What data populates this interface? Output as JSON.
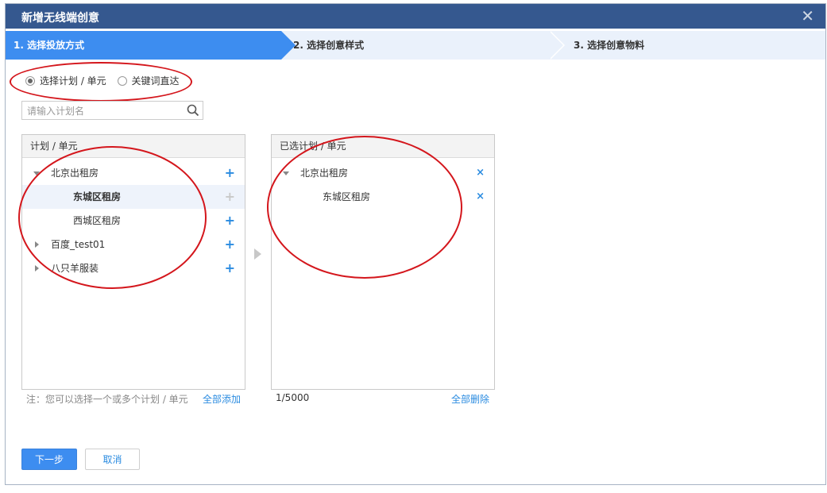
{
  "dialog": {
    "title": "新增无线端创意",
    "close_icon": "close-icon"
  },
  "steps": [
    {
      "label": "1. 选择投放方式",
      "active": true
    },
    {
      "label": "2. 选择创意样式",
      "active": false
    },
    {
      "label": "3. 选择创意物料",
      "active": false
    }
  ],
  "mode": {
    "options": [
      {
        "label": "选择计划 / 单元",
        "checked": true
      },
      {
        "label": "关键词直达",
        "checked": false
      }
    ]
  },
  "search": {
    "placeholder": "请输入计划名",
    "value": "",
    "icon": "search-icon"
  },
  "left_panel": {
    "header": "计划 / 单元",
    "items": [
      {
        "label": "北京出租房",
        "expanded": true,
        "level": 0,
        "action": "+"
      },
      {
        "label": "东城区租房",
        "level": 1,
        "selected": true,
        "action": "+",
        "disabled": true
      },
      {
        "label": "西城区租房",
        "level": 1,
        "action": "+"
      },
      {
        "label": "百度_test01",
        "level": 0,
        "expanded": false,
        "action": "+"
      },
      {
        "label": "八只羊服装",
        "level": 0,
        "expanded": false,
        "action": "+"
      }
    ],
    "note": "注：您可以选择一个或多个计划 / 单元",
    "add_all": "全部添加"
  },
  "right_panel": {
    "header": "已选计划 / 单元",
    "items": [
      {
        "label": "北京出租房",
        "level": 0,
        "expanded": true,
        "action": "×"
      },
      {
        "label": "东城区租房",
        "level": 1,
        "action": "×"
      }
    ],
    "count": "1/5000",
    "delete_all": "全部删除"
  },
  "buttons": {
    "next": "下一步",
    "cancel": "取消"
  },
  "colors": {
    "title_bar": "#35588f",
    "accent": "#3d8df0",
    "link": "#2a8be0",
    "annotation": "#d4161c"
  }
}
